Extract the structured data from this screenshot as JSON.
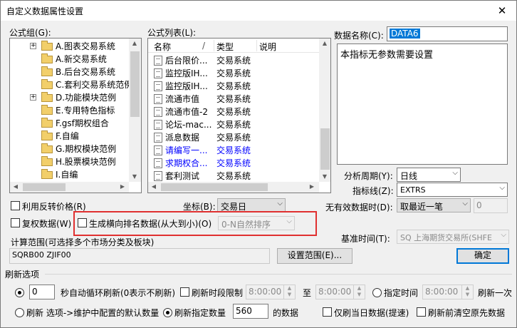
{
  "window": {
    "title": "自定义数据属性设置",
    "close_glyph": "✕"
  },
  "formula_group": {
    "label": "公式组(G):",
    "items": [
      {
        "label": "A.图表交易系统",
        "expander": "+"
      },
      {
        "label": "A.新交易系统",
        "expander": ""
      },
      {
        "label": "B.后台交易系统",
        "expander": ""
      },
      {
        "label": "C.套利交易系统范例",
        "expander": ""
      },
      {
        "label": "D.功能模块范例",
        "expander": "+"
      },
      {
        "label": "E.专用特色指标",
        "expander": ""
      },
      {
        "label": "F.gsf期权组合",
        "expander": ""
      },
      {
        "label": "F.自编",
        "expander": ""
      },
      {
        "label": "G.期权模块范例",
        "expander": ""
      },
      {
        "label": "H.股票模块范例",
        "expander": ""
      },
      {
        "label": "I.自编",
        "expander": ""
      }
    ]
  },
  "formula_list": {
    "label": "公式列表(L):",
    "columns": [
      "名称",
      "类型",
      "说明"
    ],
    "sort_glyph": "/",
    "rows": [
      {
        "name": "后台限价...",
        "type": "交易系统",
        "blue": false
      },
      {
        "name": "监控版IH...",
        "type": "交易系统",
        "blue": false
      },
      {
        "name": "监控版IH...",
        "type": "交易系统",
        "blue": false
      },
      {
        "name": "流通市值",
        "type": "交易系统",
        "blue": false
      },
      {
        "name": "流通市值-2",
        "type": "交易系统",
        "blue": false
      },
      {
        "name": "论坛-mac...",
        "type": "交易系统",
        "blue": false
      },
      {
        "name": "派息数据",
        "type": "交易系统",
        "blue": false
      },
      {
        "name": "请编写一...",
        "type": "交易系统",
        "blue": true
      },
      {
        "name": "求期权合...",
        "type": "交易系统",
        "blue": true
      },
      {
        "name": "套利测试",
        "type": "交易系统",
        "blue": false
      }
    ]
  },
  "data_name": {
    "label": "数据名称(C):",
    "value": "DATA6"
  },
  "description": "本指标无参数需要设置",
  "analysis_period": {
    "label": "分析周期(Y):",
    "value": "日线"
  },
  "indicator_line": {
    "label": "指标线(Z):",
    "value": "EXTRS"
  },
  "no_valid_data": {
    "label": "无有效数据时(D):",
    "value": "取最近一笔",
    "spin_value": "0"
  },
  "options": {
    "use_reverse_price": "利用反转价格(R)",
    "reinstate_data": "复权数据(W)",
    "generate_rank": "生成横向排名数据(从大到小)(O)",
    "rank_order": "0-N自然排序"
  },
  "coordinate": {
    "label": "坐标(B):",
    "value": "交易日"
  },
  "calc_range": {
    "label": "计算范围(可选择多个市场分类及板块)",
    "value": "SQRB00  ZJIF00",
    "set_button": "设置范围(E)..."
  },
  "base_time": {
    "label": "基准时间(T):",
    "value": "SQ 上海期货交易所(SHFE"
  },
  "ok_button": "确定",
  "refresh": {
    "section_label": "刷新选项",
    "auto_value": "0",
    "auto_label": "秒自动循环刷新(0表示不刷新)",
    "limit_label": "刷新时段限制",
    "time_from": "8:00:00",
    "to_label": "至",
    "time_to": "8:00:00",
    "specified_time_label": "指定时间",
    "specified_time": "8:00:00",
    "refresh_once_label": "刷新一次",
    "refresh_default_label": "刷新 选项->维护中配置的默认数量",
    "refresh_count_label": "刷新指定数量",
    "count_value": "560",
    "count_suffix": "的数据",
    "today_only_label": "仅刷当日数据(提速)",
    "clear_before_label": "刷新前清空原先数据"
  }
}
